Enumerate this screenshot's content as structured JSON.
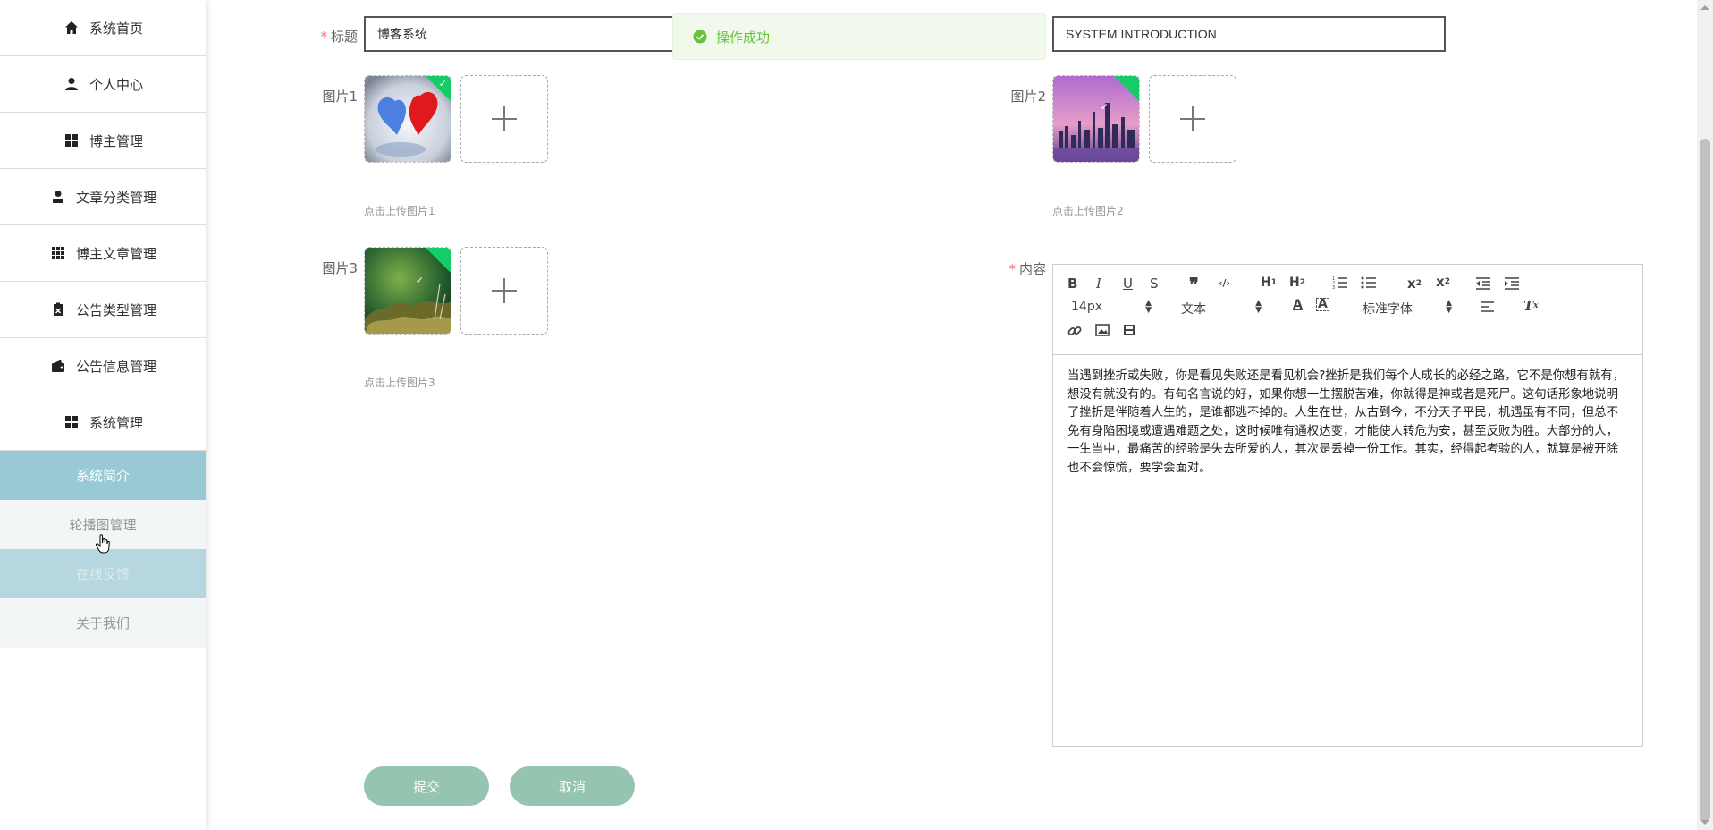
{
  "sidebar": {
    "items": [
      {
        "label": "系统首页",
        "icon": "home-icon"
      },
      {
        "label": "个人中心",
        "icon": "user-icon"
      },
      {
        "label": "博主管理",
        "icon": "grid-icon"
      },
      {
        "label": "文章分类管理",
        "icon": "person-icon"
      },
      {
        "label": "博主文章管理",
        "icon": "apps-icon"
      },
      {
        "label": "公告类型管理",
        "icon": "clipboard-icon"
      },
      {
        "label": "公告信息管理",
        "icon": "wallet-icon"
      },
      {
        "label": "系统管理",
        "icon": "grid-icon"
      }
    ],
    "submenu": [
      {
        "label": "系统简介",
        "state": "active"
      },
      {
        "label": "轮播图管理",
        "state": "normal"
      },
      {
        "label": "在线反馈",
        "state": "hover"
      },
      {
        "label": "关于我们",
        "state": "normal"
      }
    ]
  },
  "form": {
    "title_label": "标题",
    "title_value": "博客系统",
    "subtitle_value": "SYSTEM INTRODUCTION",
    "image1_label": "图片1",
    "image1_hint": "点击上传图片1",
    "image2_label": "图片2",
    "image2_hint": "点击上传图片2",
    "image3_label": "图片3",
    "image3_hint": "点击上传图片3",
    "content_label": "内容",
    "required_mark": "*"
  },
  "toast": {
    "text": "操作成功",
    "color": "#67c23a"
  },
  "editor": {
    "font_size": "14px",
    "block_format": "文本",
    "font_family": "标准字体",
    "content": "当遇到挫折或失败，你是看见失败还是看见机会?挫折是我们每个人成长的必经之路，它不是你想有就有，想没有就没有的。有句名言说的好，如果你想一生摆脱苦难，你就得是神或者是死尸。这句话形象地说明了挫折是伴随着人生的，是谁都逃不掉的。人生在世，从古到今，不分天子平民，机遇虽有不同，但总不免有身陷困境或遭遇难题之处，这时候唯有通权达变，才能使人转危为安，甚至反败为胜。大部分的人，一生当中，最痛苦的经验是失去所爱的人，其次是丢掉一份工作。其实，经得起考验的人，就算是被开除也不会惊慌，要学会面对。"
  },
  "buttons": {
    "submit": "提交",
    "cancel": "取消"
  },
  "colors": {
    "accent": "#9ac9d6",
    "button": "#95c5b0",
    "success_corner": "#13ce66",
    "required": "#f56c6c"
  }
}
